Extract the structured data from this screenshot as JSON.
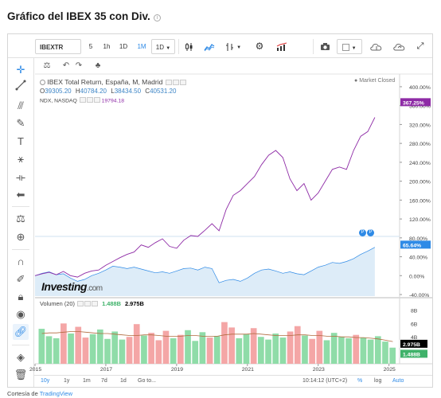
{
  "page": {
    "title": "Gráfico del IBEX 35 con Div."
  },
  "toolbar": {
    "symbol": "IBEXTR",
    "intervals": [
      "5",
      "1h",
      "1D",
      "1M"
    ],
    "active_interval": "1M",
    "interval_dropdown": "1D"
  },
  "legend": {
    "main": "IBEX Total Return, España, M, Madrid",
    "ohlc": {
      "o_label": "O",
      "o": "39305.20",
      "h_label": "H",
      "h": "40784.20",
      "l_label": "L",
      "l": "38434.50",
      "c_label": "C",
      "c": "40531.20"
    },
    "ndx_label": "NDX, NASDAQ",
    "ndx_value": "19794.18",
    "market_status": "Market Closed",
    "volume_label": "Volumen (20)",
    "volume_value1": "1.488B",
    "volume_value2": "2.975B"
  },
  "watermark": {
    "brand": "Investing",
    "suffix": ".com"
  },
  "flag_markers": [
    "P",
    "P"
  ],
  "bottombar": {
    "ranges": [
      "10y",
      "1y",
      "1m",
      "7d",
      "1d",
      "Go to..."
    ],
    "active_range": "10y",
    "time": "10:14:12 (UTC+2)",
    "percent": "%",
    "log": "log",
    "auto": "Auto"
  },
  "credit": {
    "prefix": "Cortesía de",
    "link": "TradingView"
  },
  "colors": {
    "ndx_line": "#8e2ba6",
    "ibex_area_fill": "#ddecf8",
    "ibex_area_line": "#2e8ae6",
    "vol_up": "#8fdca8",
    "vol_down": "#f4a6a6",
    "ma_line": "#b26b3f",
    "accent": "#2e8ae6"
  },
  "chart_data": {
    "type": "line",
    "x_ticks": [
      "2015",
      "2017",
      "2019",
      "2021",
      "2023",
      "2025"
    ],
    "y_ticks_price": [
      "400.00%",
      "360.00%",
      "320.00%",
      "280.00%",
      "240.00%",
      "200.00%",
      "160.00%",
      "120.00%",
      "80.00%",
      "40.00%",
      "0.00%",
      "-40.00%"
    ],
    "y_ticks_volume": [
      "8B",
      "6B",
      "4B"
    ],
    "price_badges": {
      "ndx": {
        "label": "367.25%",
        "value": 367.25,
        "color": "#8e2ba6"
      },
      "ibex": {
        "label": "65.64%",
        "value": 65.64,
        "color": "#2e8ae6"
      }
    },
    "volume_badges": {
      "ma": {
        "label": "2.975B",
        "value": 2.975,
        "color": "#000000"
      },
      "vol": {
        "label": "1.488B",
        "value": 1.488,
        "color": "#3fb26a"
      }
    },
    "x_range": [
      2015.0,
      2025.3
    ],
    "y_range": [
      -45,
      410
    ],
    "volume_range": [
      0,
      9
    ],
    "series": [
      {
        "name": "NDX, NASDAQ",
        "x": [
          2015.0,
          2015.2,
          2015.4,
          2015.6,
          2015.8,
          2016.0,
          2016.2,
          2016.4,
          2016.6,
          2016.8,
          2017.0,
          2017.2,
          2017.4,
          2017.6,
          2017.8,
          2018.0,
          2018.2,
          2018.4,
          2018.6,
          2018.8,
          2019.0,
          2019.2,
          2019.4,
          2019.6,
          2019.8,
          2020.0,
          2020.2,
          2020.4,
          2020.6,
          2020.8,
          2021.0,
          2021.2,
          2021.4,
          2021.6,
          2021.8,
          2022.0,
          2022.2,
          2022.4,
          2022.6,
          2022.8,
          2023.0,
          2023.2,
          2023.4,
          2023.6,
          2023.8,
          2024.0,
          2024.2,
          2024.4,
          2024.6
        ],
        "values": [
          0,
          4,
          7,
          2,
          9,
          0,
          -3,
          5,
          10,
          12,
          22,
          30,
          38,
          45,
          50,
          65,
          60,
          70,
          78,
          62,
          58,
          75,
          85,
          83,
          96,
          110,
          95,
          140,
          170,
          180,
          195,
          210,
          235,
          255,
          265,
          250,
          205,
          180,
          195,
          160,
          175,
          200,
          225,
          230,
          225,
          265,
          295,
          305,
          335
        ]
      },
      {
        "name": "IBEX Total Return",
        "x": [
          2015.0,
          2015.2,
          2015.4,
          2015.6,
          2015.8,
          2016.0,
          2016.2,
          2016.4,
          2016.6,
          2016.8,
          2017.0,
          2017.2,
          2017.4,
          2017.6,
          2017.8,
          2018.0,
          2018.2,
          2018.4,
          2018.6,
          2018.8,
          2019.0,
          2019.2,
          2019.4,
          2019.6,
          2019.8,
          2020.0,
          2020.2,
          2020.4,
          2020.6,
          2020.8,
          2021.0,
          2021.2,
          2021.4,
          2021.6,
          2021.8,
          2022.0,
          2022.2,
          2022.4,
          2022.6,
          2022.8,
          2023.0,
          2023.2,
          2023.4,
          2023.6,
          2023.8,
          2024.0,
          2024.2,
          2024.4,
          2024.6
        ],
        "values": [
          0,
          5,
          8,
          2,
          4,
          -5,
          -12,
          -8,
          0,
          5,
          12,
          20,
          18,
          15,
          18,
          14,
          10,
          6,
          8,
          5,
          10,
          15,
          16,
          12,
          18,
          15,
          -15,
          -10,
          -8,
          -12,
          -5,
          5,
          12,
          14,
          10,
          5,
          8,
          4,
          2,
          10,
          18,
          22,
          28,
          26,
          30,
          36,
          45,
          52,
          60
        ]
      }
    ],
    "volume": {
      "name": "Volumen (20)",
      "values_billion": [
        5.2,
        4.1,
        3.8,
        6.0,
        4.5,
        5.5,
        3.9,
        4.4,
        5.1,
        3.7,
        4.8,
        3.6,
        4.0,
        5.9,
        4.2,
        4.6,
        3.5,
        4.9,
        3.8,
        4.3,
        5.0,
        3.4,
        4.7,
        3.9,
        4.1,
        6.2,
        5.4,
        3.8,
        4.4,
        5.3,
        4.0,
        3.6,
        4.5,
        3.9,
        4.8,
        5.6,
        4.2,
        3.7,
        4.9,
        3.5,
        4.6,
        4.0,
        3.8,
        4.3,
        3.9,
        3.6,
        4.1,
        3.3,
        2.4
      ],
      "ma_billion": [
        4.5,
        4.6,
        4.6,
        4.7,
        4.8,
        4.8,
        4.7,
        4.6,
        4.5,
        4.5,
        4.4,
        4.3,
        4.2,
        4.2,
        4.3,
        4.3,
        4.2,
        4.1,
        4.1,
        4.1,
        4.2,
        4.2,
        4.1,
        4.1,
        4.1,
        4.3,
        4.4,
        4.4,
        4.4,
        4.5,
        4.4,
        4.3,
        4.2,
        4.2,
        4.2,
        4.3,
        4.3,
        4.2,
        4.2,
        4.1,
        4.1,
        4.0,
        4.0,
        3.9,
        3.9,
        3.8,
        3.7,
        3.5,
        3.3
      ]
    }
  }
}
